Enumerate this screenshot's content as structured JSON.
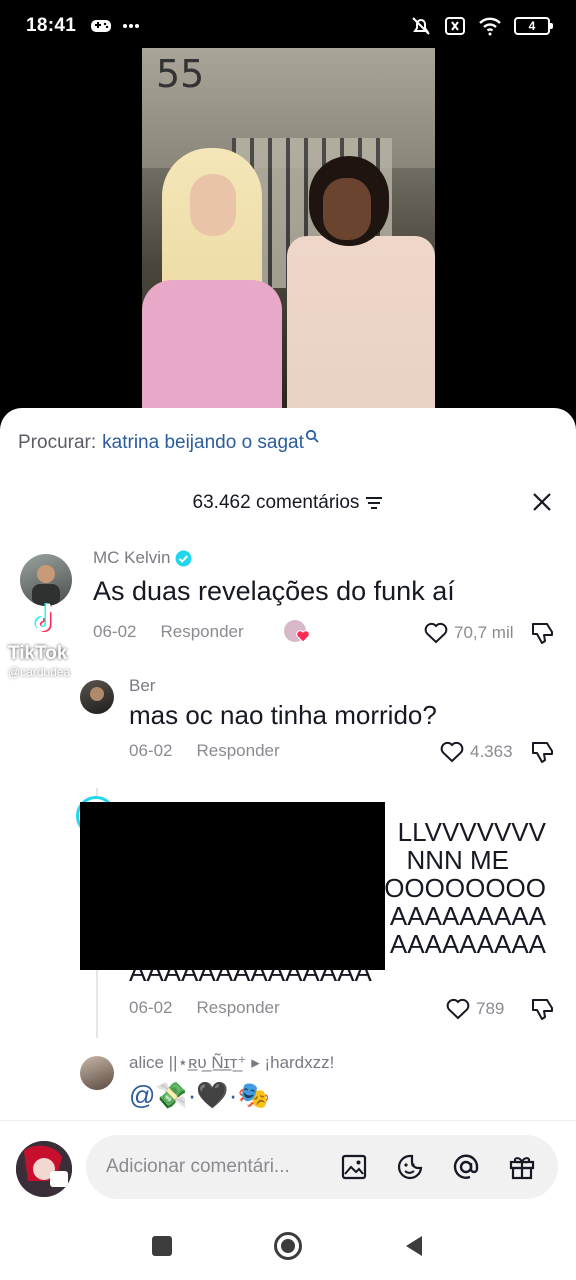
{
  "status_bar": {
    "time": "18:41",
    "battery": "4"
  },
  "video": {
    "wall_number": "55"
  },
  "watermark": {
    "name": "TikTok",
    "handle": "@cardudea"
  },
  "search": {
    "prefix": "Procurar:",
    "query": "katrina beijando o sagat"
  },
  "header": {
    "count_label": "63.462 comentários"
  },
  "comments": [
    {
      "author": "MC Kelvin",
      "verified": true,
      "text": "As duas revelações do funk aí",
      "date": "06-02",
      "reply_label": "Responder",
      "likes": "70,7 mil"
    },
    {
      "author": "Ber",
      "text": "mas oc nao tinha morrido?",
      "date": "06-02",
      "reply_label": "Responder",
      "likes": "4.363"
    },
    {
      "lines": [
        "LLVVVVVVV",
        "NNN ME",
        "OOOOOOOO",
        "AAAAAAAAA",
        "AAAAAAAAA",
        "AAAAAAAAAAAAAA"
      ],
      "date": "06-02",
      "reply_label": "Responder",
      "likes": "789"
    },
    {
      "author": "alice ||⋆ʀ̲ᴜ̲ Ñ̲ɪ̲ᴛ̲⁺ ▸ ¡hardxzz!",
      "text": "@💸·🖤·🎭",
      "date": "",
      "reply_label": ""
    }
  ],
  "input": {
    "placeholder": "Adicionar comentári..."
  },
  "colors": {
    "link_blue": "#2b5c9e",
    "verified": "#20d5ec",
    "heart_outline": "#161823"
  }
}
